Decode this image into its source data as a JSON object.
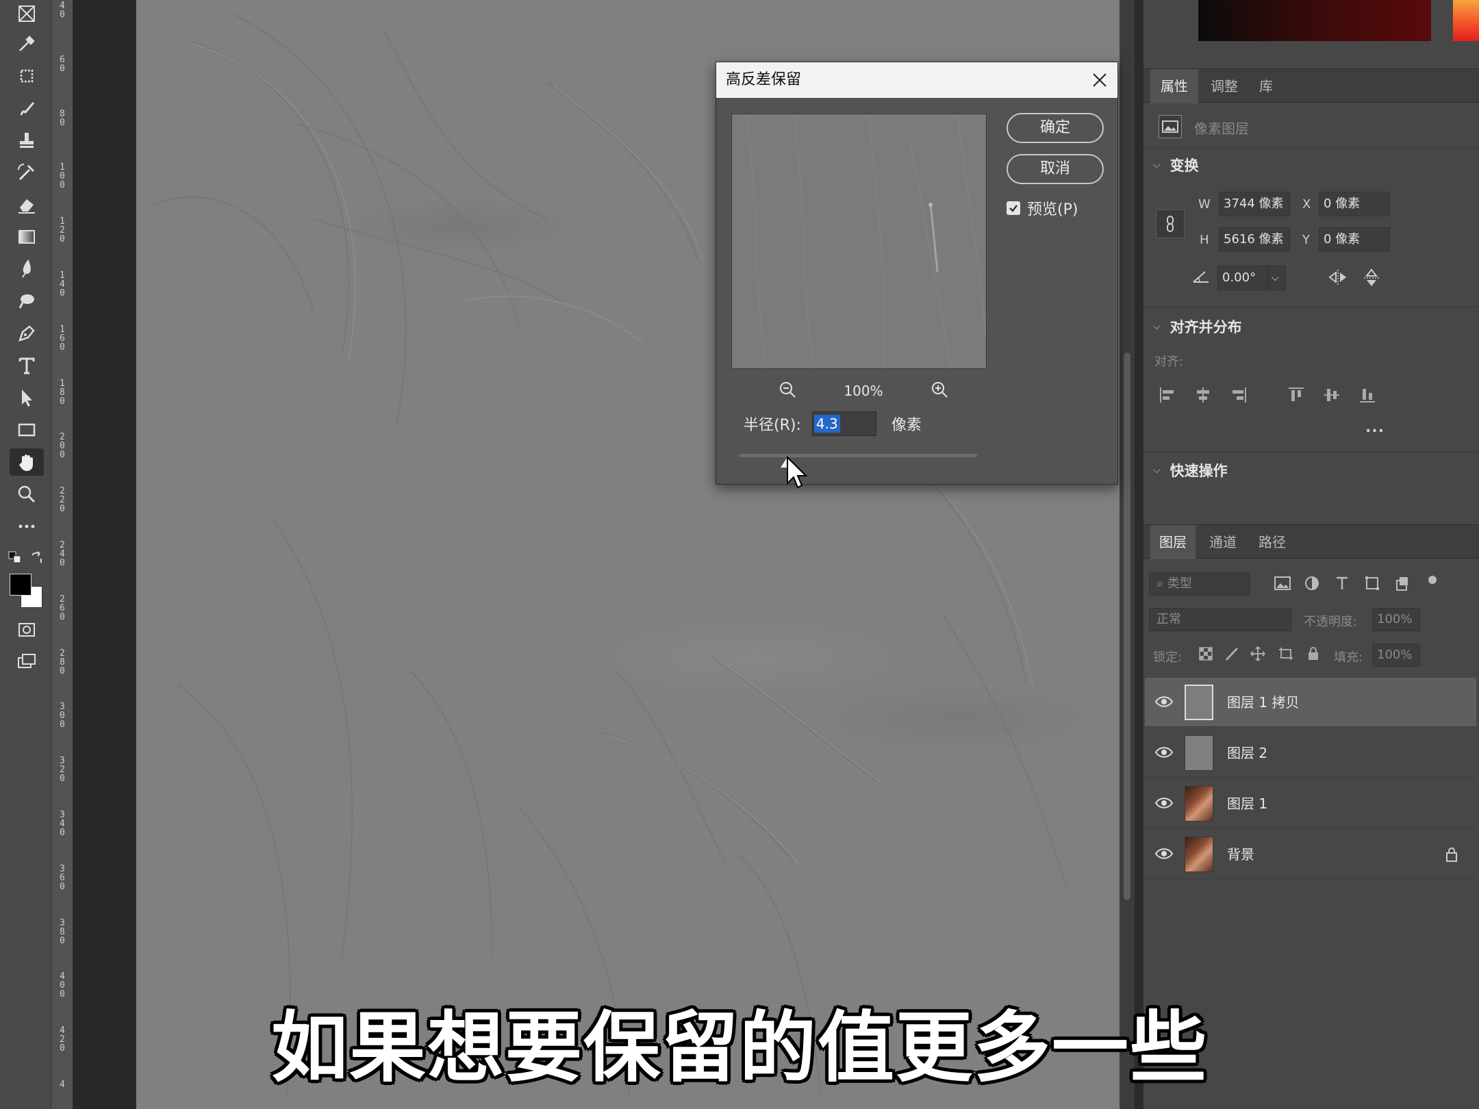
{
  "toolbar": {
    "tools": [
      "close-icon",
      "eyedropper-icon",
      "crop-icon",
      "brush-icon",
      "stamp-icon",
      "history-brush-icon",
      "eraser-icon",
      "gradient-icon",
      "blur-icon",
      "dodge-icon",
      "pen-icon",
      "type-icon",
      "path-select-icon",
      "rectangle-icon",
      "hand-icon",
      "zoom-icon",
      "more-icon"
    ],
    "active_tool": "hand-icon"
  },
  "ruler": {
    "labels": [
      "4\n0",
      "6\n0",
      "8\n0",
      "1\n0\n0",
      "1\n2\n0",
      "1\n4\n0",
      "1\n6\n0",
      "1\n8\n0",
      "2\n0\n0",
      "2\n2\n0",
      "2\n4\n0",
      "2\n6\n0",
      "2\n8\n0",
      "3\n0\n0",
      "3\n2\n0",
      "3\n4\n0",
      "3\n6\n0",
      "3\n8\n0",
      "4\n0\n0",
      "4\n2\n0",
      "4"
    ]
  },
  "dialog": {
    "title": "高反差保留",
    "ok_label": "确定",
    "cancel_label": "取消",
    "preview_label": "预览(P)",
    "preview_checked": true,
    "zoom_level": "100%",
    "radius_label": "半径(R):",
    "radius_value": "4.3",
    "radius_unit": "像素",
    "slider_fraction": 0.2
  },
  "properties": {
    "tabs": [
      "属性",
      "调整",
      "库"
    ],
    "active_tab": "属性",
    "layer_type": "像素图层",
    "transform": {
      "heading": "变换",
      "w_label": "W",
      "w_value": "3744 像素",
      "h_label": "H",
      "h_value": "5616 像素",
      "x_label": "X",
      "x_value": "0 像素",
      "y_label": "Y",
      "y_value": "0 像素",
      "angle_value": "0.00°"
    },
    "align": {
      "heading": "对齐并分布",
      "align_label": "对齐:",
      "more": "..."
    },
    "quick_actions": {
      "heading": "快速操作"
    }
  },
  "layers_panel": {
    "tabs": [
      "图层",
      "通道",
      "路径"
    ],
    "active_tab": "图层",
    "filter_placeholder": "类型",
    "blend_mode": "正常",
    "opacity_label": "不透明度:",
    "opacity_value": "100%",
    "lock_label": "锁定:",
    "fill_label": "填充:",
    "fill_value": "100%",
    "layers": [
      {
        "name": "图层 1 拷贝",
        "selected": true,
        "thumb": "gray"
      },
      {
        "name": "图层 2",
        "selected": false,
        "thumb": "gray"
      },
      {
        "name": "图层 1",
        "selected": false,
        "thumb": "portrait"
      },
      {
        "name": "背景",
        "selected": false,
        "thumb": "portrait",
        "locked": true
      }
    ]
  },
  "subtitle": "如果想要保留的值更多一些",
  "colors": {
    "accent_selection": "#2467c8",
    "canvas_gray": "#808080",
    "panel_bg": "#474747"
  }
}
